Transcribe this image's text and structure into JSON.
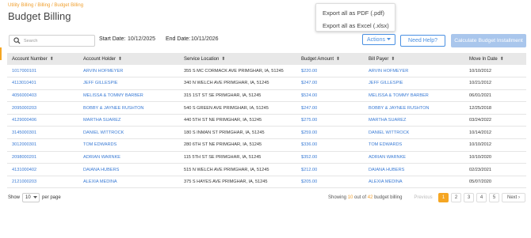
{
  "breadcrumb": {
    "part1": "Utility Billing",
    "sep1": " / ",
    "part2": "Billing",
    "sep2": " / ",
    "part3": "Budget Billing"
  },
  "page_title": "Budget Billing",
  "search": {
    "placeholder": "Search"
  },
  "start_date": {
    "label": "Start Date:",
    "value": "10/12/2025"
  },
  "end_date": {
    "label": "End Date:",
    "value": "10/11/2026"
  },
  "export_menu": {
    "pdf": "Export all as PDF (.pdf)",
    "excel": "Export all as Excel (.xlsx)"
  },
  "buttons": {
    "actions": "Actions",
    "help": "Need Help?",
    "calculate": "Calculate Budget Installment"
  },
  "table": {
    "headers": {
      "account_number": "Account Number",
      "account_holder": "Account Holder",
      "service_location": "Service Location",
      "budget_amount": "Budget Amount",
      "bill_payer": "Bill Payer",
      "move_in_date": "Move In Date"
    },
    "rows": [
      {
        "account_number": "1017000101",
        "account_holder": "ARVIN HOFMEYER",
        "service_location": "355 S MC CORMACK AVE PRIMGHAR, IA, 51245",
        "budget_amount": "$220.00",
        "bill_payer": "ARVIN HOFMEYER",
        "move_in_date": "10/10/2012"
      },
      {
        "account_number": "4113010401",
        "account_holder": "JEFF GILLESPIE",
        "service_location": "340 N WELCH AVE PRIMGHAR, IA, 51245",
        "budget_amount": "$247.00",
        "bill_payer": "JEFF GILLESPIE",
        "move_in_date": "10/21/2012"
      },
      {
        "account_number": "4056000403",
        "account_holder": "MELISSA & TOMMY BARBER",
        "service_location": "315 1ST ST SE PRIMGHAR, IA, 51245",
        "budget_amount": "$524.00",
        "bill_payer": "MELISSA & TOMMY BARBER",
        "move_in_date": "06/01/2021"
      },
      {
        "account_number": "2095000203",
        "account_holder": "BOBBY & JAYNEE RUSHTON",
        "service_location": "540 S GREEN AVE PRIMGHAR, IA, 51245",
        "budget_amount": "$247.00",
        "bill_payer": "BOBBY & JAYNEE RUSHTON",
        "move_in_date": "12/25/2018"
      },
      {
        "account_number": "4129000406",
        "account_holder": "MARTHA SUAREZ",
        "service_location": "440 5TH ST NE PRIMGHAR, IA, 51245",
        "budget_amount": "$275.00",
        "bill_payer": "MARTHA SUAREZ",
        "move_in_date": "03/24/2022"
      },
      {
        "account_number": "3145000301",
        "account_holder": "DANIEL WITTROCK",
        "service_location": "180 S INMAN ST PRIMGHAR, IA, 51245",
        "budget_amount": "$259.00",
        "bill_payer": "DANIEL WITTROCK",
        "move_in_date": "10/14/2012"
      },
      {
        "account_number": "3012000301",
        "account_holder": "TOM EDWARDS",
        "service_location": "280 6TH ST NE PRIMGHAR, IA, 51245",
        "budget_amount": "$336.00",
        "bill_payer": "TOM EDWARDS",
        "move_in_date": "10/10/2012"
      },
      {
        "account_number": "2098000201",
        "account_holder": "ADRIAN WARNKE",
        "service_location": "115 5TH ST SE PRIMGHAR, IA, 51245",
        "budget_amount": "$352.00",
        "bill_payer": "ADRIAN WARNKE",
        "move_in_date": "10/10/2020"
      },
      {
        "account_number": "4131000402",
        "account_holder": "DAIANA HUBERS",
        "service_location": "515 N WELCH AVE PRIMGHAR, IA, 51245",
        "budget_amount": "$212.00",
        "bill_payer": "DAIANA HUBERS",
        "move_in_date": "02/23/2021"
      },
      {
        "account_number": "2121000203",
        "account_holder": "ALEXIA MEDINA",
        "service_location": "375 S HAYES AVE PRIMGHAR, IA, 51245",
        "budget_amount": "$205.00",
        "bill_payer": "ALEXIA MEDINA",
        "move_in_date": "05/07/2020"
      }
    ]
  },
  "footer": {
    "show_label": "Show",
    "page_size": "10",
    "per_page_label": "per page",
    "showing_prefix": "Showing",
    "showing_count": "10",
    "showing_mid": "out of",
    "showing_total": "42",
    "showing_suffix": "budget billing",
    "prev_label": "Previous",
    "next_label": "Next",
    "pages": [
      "1",
      "2",
      "3",
      "4",
      "5"
    ],
    "active_page": "1"
  },
  "colors": {
    "accent": "#f5a623",
    "link": "#3a7bd5",
    "primary_button": "#a9c6ec",
    "outline_button": "#4a90e2"
  }
}
